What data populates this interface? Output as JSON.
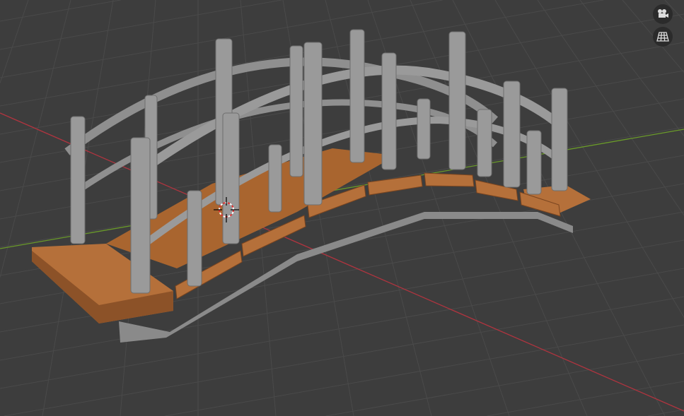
{
  "viewport": {
    "background_color": "#3d3d3d",
    "grid_color": "#4a4a4a",
    "x_axis_color": "#b0343f",
    "y_axis_color": "#6a9a2a"
  },
  "object": {
    "deck_color": "#b5703a",
    "frame_color": "#8f8f8f"
  },
  "nav_gizmo": {
    "buttons": [
      {
        "icon": "camera-icon"
      },
      {
        "icon": "perspective-grid-icon"
      }
    ]
  }
}
